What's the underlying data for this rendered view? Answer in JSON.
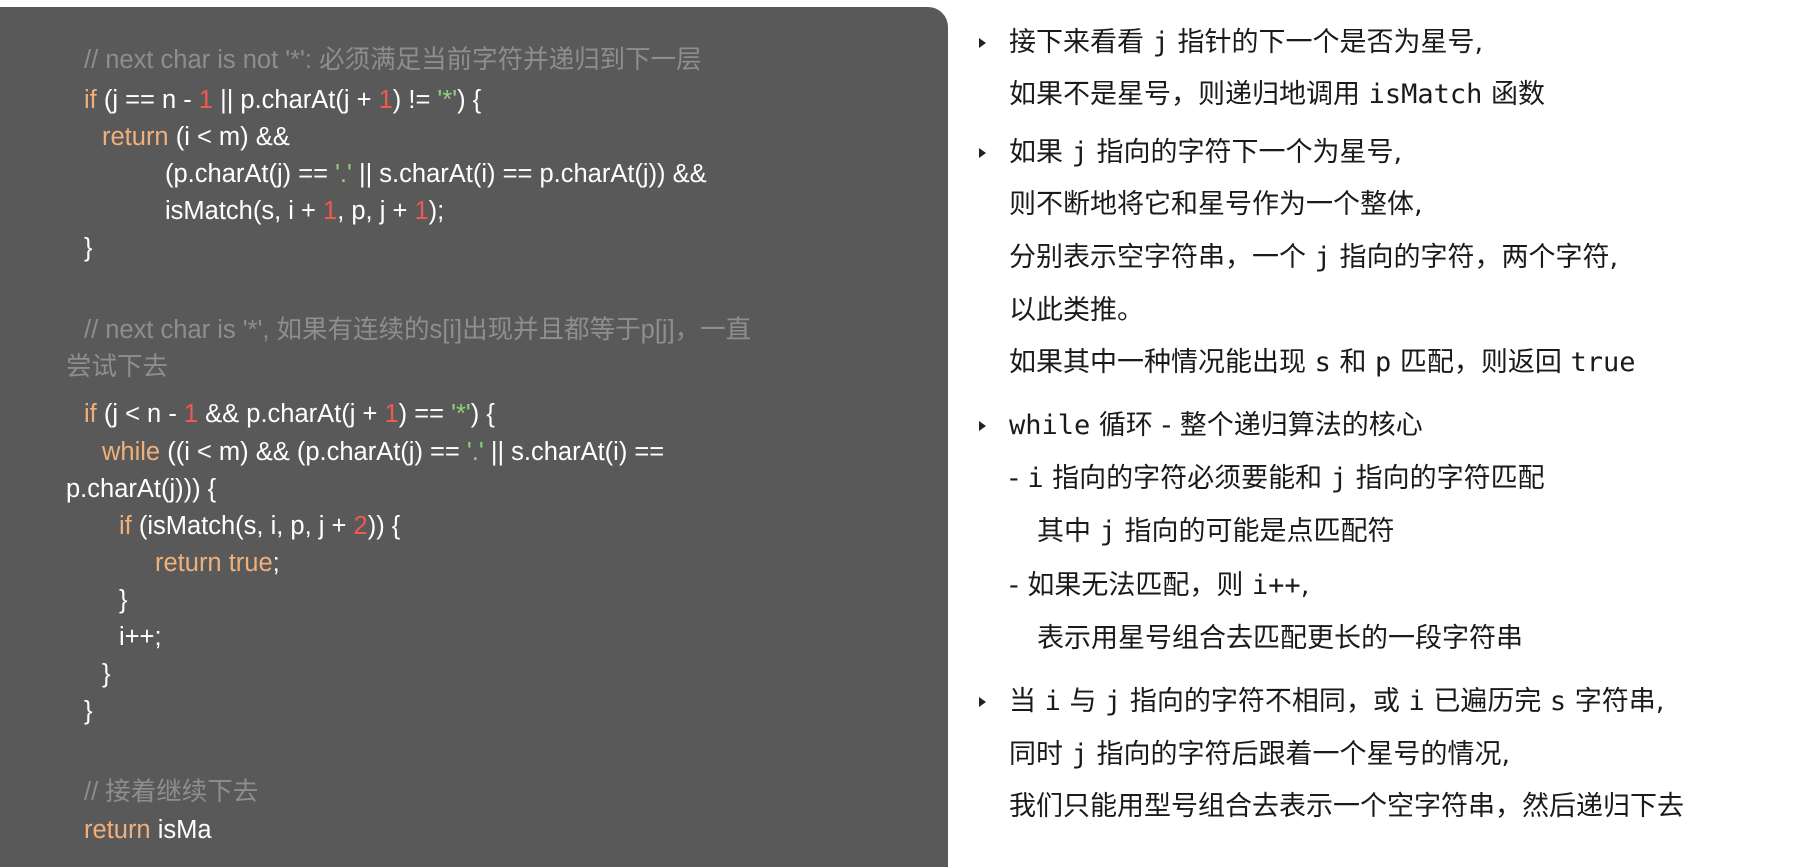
{
  "code": {
    "comment1": "// next char is not '*': 必须满足当前字符并递归到下一层",
    "line_if1": [
      "if",
      " (j == n - ",
      "1",
      " || p.charAt(j + ",
      "1",
      ") != ",
      "'*'",
      ") {"
    ],
    "line_return1": [
      "return",
      " (i < m) &&"
    ],
    "line_cond1": [
      "(p.charAt(j) == ",
      "'.'",
      " || s.charAt(i) == p.charAt(j)) &&"
    ],
    "line_ismatch1": [
      "isMatch(s, i + ",
      "1",
      ", p, j + ",
      "1",
      ");"
    ],
    "close1": "}",
    "comment2a": "// next char is '*', 如果有连续的s[i]出现并且都等于p[j]，一直",
    "comment2b": "尝试下去",
    "line_if2": [
      "if",
      " (j < n - ",
      "1",
      " && p.charAt(j + ",
      "1",
      ") == ",
      "'*'",
      ") {"
    ],
    "line_while": [
      "while",
      " ((i < m) && (p.charAt(j) == ",
      "'.'",
      " || s.charAt(i) =="
    ],
    "line_while_cont": "p.charAt(j))) {",
    "line_if3": [
      "if",
      " (isMatch(s, i, p, j + ",
      "2",
      ")) {"
    ],
    "line_return_true": [
      "return true",
      ";"
    ],
    "close2": "}",
    "line_incr": "i++;",
    "close3": "}",
    "close4": "}",
    "comment3": "// 接着继续下去",
    "line_return_last": [
      "return",
      " isMa"
    ]
  },
  "notes": {
    "b1_l1": [
      "接下来看看 ",
      "j",
      " 指针的下一个是否为星号,"
    ],
    "b1_l2": [
      "如果不是星号，则递归地调用 ",
      "isMatch",
      " 函数"
    ],
    "b2_l1": [
      "如果 ",
      "j",
      " 指向的字符下一个为星号,"
    ],
    "b2_l2": "则不断地将它和星号作为一个整体,",
    "b2_l3": [
      "分别表示空字符串，一个 ",
      "j",
      " 指向的字符，两个字符,"
    ],
    "b2_l4": "以此类推。",
    "b2_l5": [
      "如果其中一种情况能出现 ",
      "s",
      " 和 ",
      "p",
      " 匹配，则返回 ",
      "true"
    ],
    "b3_l1": [
      "while",
      " 循环 - 整个递归算法的核心"
    ],
    "b3_l2": [
      "- ",
      "i",
      " 指向的字符必须要能和 ",
      "j",
      " 指向的字符匹配"
    ],
    "b3_l3": [
      "其中 ",
      "j",
      " 指向的可能是点匹配符"
    ],
    "b3_l4": [
      "- 如果无法匹配，则 ",
      "i++",
      ","
    ],
    "b3_l5": "表示用星号组合去匹配更长的一段字符串",
    "b4_l1": [
      "当 ",
      "i",
      " 与 ",
      "j",
      " 指向的字符不相同，或 ",
      "i",
      " 已遍历完 ",
      "s",
      " 字符串,"
    ],
    "b4_l2": [
      "同时 ",
      "j",
      " 指向的字符后跟着一个星号的情况,"
    ],
    "b4_l3": "我们只能用型号组合去表示一个空字符串，然后递归下去"
  }
}
